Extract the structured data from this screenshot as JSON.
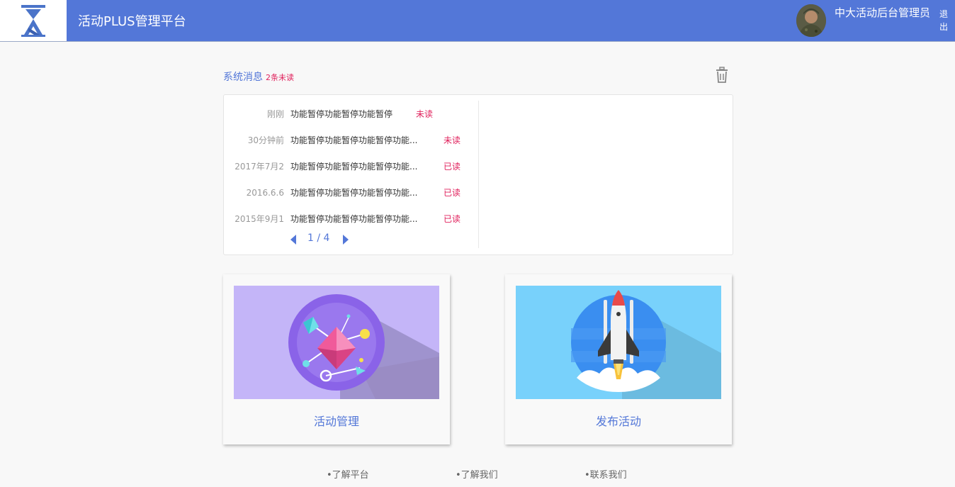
{
  "header": {
    "app_title": "活动PLUS管理平台",
    "admin_name": "中大活动后台管理员",
    "logout_label": "退出",
    "brand_color": "#5377d8"
  },
  "messages": {
    "title": "系统消息",
    "unread_count_label": "2条未读",
    "items": [
      {
        "time": "刚刚",
        "text": "功能暂停功能暂停功能暂停",
        "status": "未读"
      },
      {
        "time": "30分钟前",
        "text": "功能暂停功能暂停功能暂停功能...",
        "status": "未读"
      },
      {
        "time": "2017年7月2",
        "text": "功能暂停功能暂停功能暂停功能...",
        "status": "已读"
      },
      {
        "time": "2016.6.6",
        "text": "功能暂停功能暂停功能暂停功能...",
        "status": "已读"
      },
      {
        "time": "2015年9月1",
        "text": "功能暂停功能暂停功能暂停功能...",
        "status": "已读"
      }
    ],
    "pager": {
      "current": 1,
      "total": 4,
      "label": "1 / 4"
    }
  },
  "cards": [
    {
      "label": "活动管理",
      "icon": "diamond-illustration"
    },
    {
      "label": "发布活动",
      "icon": "rocket-illustration"
    }
  ],
  "footer": {
    "links": [
      "•了解平台",
      "•了解我们",
      "•联系我们"
    ]
  }
}
